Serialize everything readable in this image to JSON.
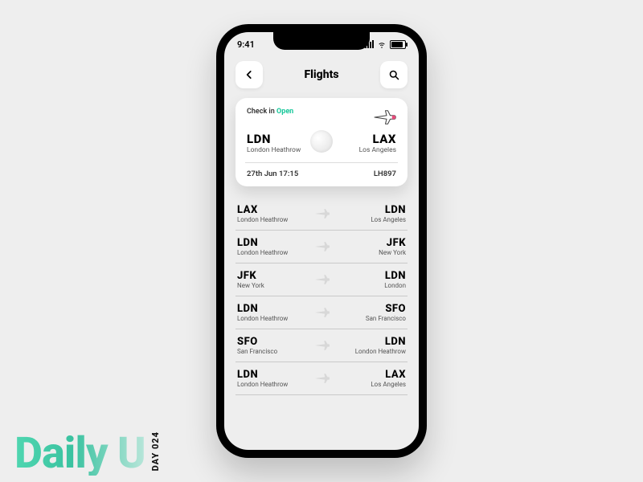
{
  "branding": {
    "main": "Daily U",
    "side": "DAY 024"
  },
  "status": {
    "time": "9:41"
  },
  "header": {
    "title": "Flights"
  },
  "featured": {
    "checkin_label": "Check in",
    "checkin_status": "Open",
    "from_code": "LDN",
    "from_airport": "London Heathrow",
    "to_code": "LAX",
    "to_airport": "Los Angeles",
    "datetime": "27th Jun 17:15",
    "flight_no": "LH897"
  },
  "flights": [
    {
      "from_code": "LAX",
      "from_airport": "London Heathrow",
      "to_code": "LDN",
      "to_airport": "Los Angeles"
    },
    {
      "from_code": "LDN",
      "from_airport": "London Heathrow",
      "to_code": "JFK",
      "to_airport": "New York"
    },
    {
      "from_code": "JFK",
      "from_airport": "New York",
      "to_code": "LDN",
      "to_airport": "London"
    },
    {
      "from_code": "LDN",
      "from_airport": "London Heathrow",
      "to_code": "SFO",
      "to_airport": "San Francisco"
    },
    {
      "from_code": "SFO",
      "from_airport": "San Francisco",
      "to_code": "LDN",
      "to_airport": "London Heathrow"
    },
    {
      "from_code": "LDN",
      "from_airport": "London Heathrow",
      "to_code": "LAX",
      "to_airport": "Los Angeles"
    }
  ],
  "colors": {
    "accent": "#16c79a"
  }
}
